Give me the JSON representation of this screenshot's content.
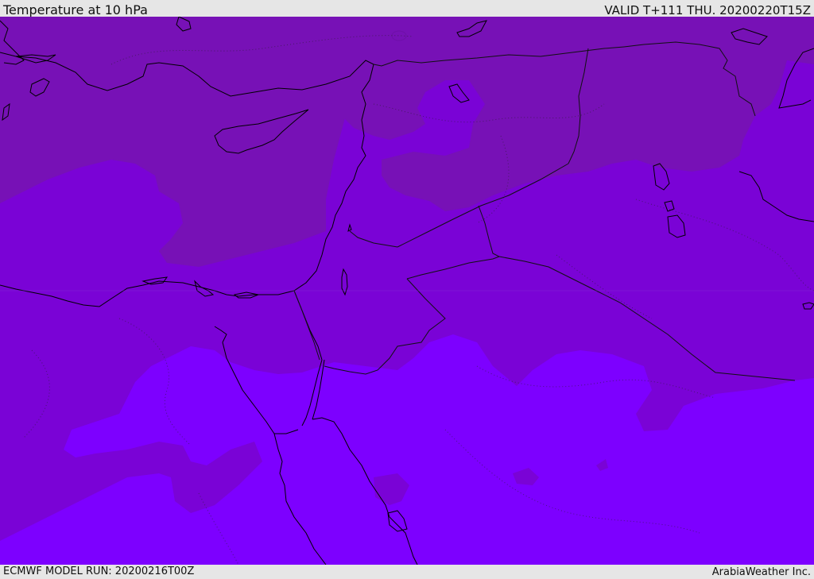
{
  "header": {
    "title": "Temperature at 10 hPa",
    "valid_time": "VALID T+111 THU. 20200220T15Z"
  },
  "footer": {
    "model_run": "ECMWF MODEL RUN: 20200216T00Z",
    "credit": "ArabiaWeather Inc."
  },
  "map": {
    "colors": {
      "band_dark": "#7711B6",
      "band_mid": "#7A03D6",
      "band_bright": "#7D00FF",
      "coast": "#000000",
      "border": "#000000"
    }
  }
}
